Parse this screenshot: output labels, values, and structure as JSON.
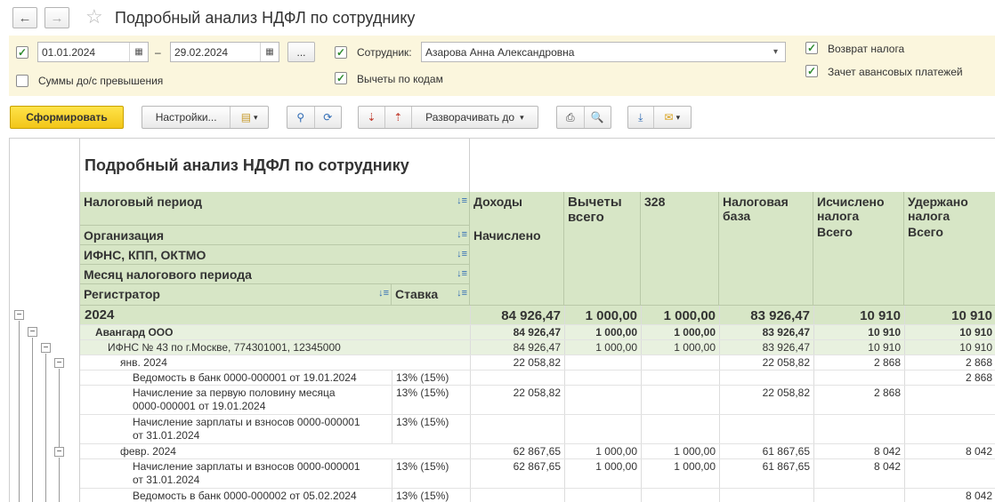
{
  "window": {
    "title": "Подробный анализ НДФЛ по сотруднику"
  },
  "filters": {
    "date_from": "01.01.2024",
    "date_to": "29.02.2024",
    "dash": "–",
    "dots": "...",
    "employee_label": "Сотрудник:",
    "employee_value": "Азарова Анна Александровна",
    "amounts_label": "Суммы до/с превышения",
    "deductions_label": "Вычеты по кодам",
    "refund_label": "Возврат налога",
    "advance_label": "Зачет авансовых платежей"
  },
  "toolbar": {
    "generate": "Сформировать",
    "settings": "Настройки...",
    "expand": "Разворачивать до"
  },
  "report": {
    "title": "Подробный анализ НДФЛ по сотруднику",
    "headers": {
      "period": "Налоговый период",
      "org": "Организация",
      "ifns": "ИФНС, КПП, ОКТМО",
      "month": "Месяц налогового периода",
      "registrar": "Регистратор",
      "rate": "Ставка",
      "income": "Доходы",
      "accrued": "Начислено",
      "deductions": "Вычеты всего",
      "code328": "328",
      "base": "Налоговая база",
      "calc": "Исчислено налога",
      "calc_total": "Всего",
      "withheld": "Удержано налога",
      "withheld_total": "Всего"
    },
    "rows": [
      {
        "label": "2024",
        "rate": "",
        "income": "84 926,47",
        "ded": "1 000,00",
        "c328": "1 000,00",
        "base": "83 926,47",
        "calc": "10 910",
        "with": "10 910"
      },
      {
        "label": "Авангард ООО",
        "rate": "",
        "income": "84 926,47",
        "ded": "1 000,00",
        "c328": "1 000,00",
        "base": "83 926,47",
        "calc": "10 910",
        "with": "10 910"
      },
      {
        "label": "ИФНС № 43 по г.Москве, 774301001, 12345000",
        "rate": "",
        "income": "84 926,47",
        "ded": "1 000,00",
        "c328": "1 000,00",
        "base": "83 926,47",
        "calc": "10 910",
        "with": "10 910"
      },
      {
        "label": "янв. 2024",
        "rate": "",
        "income": "22 058,82",
        "ded": "",
        "c328": "",
        "base": "22 058,82",
        "calc": "2 868",
        "with": "2 868"
      },
      {
        "label": "Ведомость в банк 0000-000001 от 19.01.2024",
        "rate": "13% (15%)",
        "income": "",
        "ded": "",
        "c328": "",
        "base": "",
        "calc": "",
        "with": "2 868"
      },
      {
        "label": "Начисление за первую половину месяца",
        "label2": "0000-000001 от 19.01.2024",
        "rate": "13% (15%)",
        "income": "22 058,82",
        "ded": "",
        "c328": "",
        "base": "22 058,82",
        "calc": "2 868",
        "with": ""
      },
      {
        "label": "Начисление зарплаты и взносов 0000-000001",
        "label2": "от 31.01.2024",
        "rate": "13% (15%)",
        "income": "",
        "ded": "",
        "c328": "",
        "base": "",
        "calc": "",
        "with": ""
      },
      {
        "label": "февр. 2024",
        "rate": "",
        "income": "62 867,65",
        "ded": "1 000,00",
        "c328": "1 000,00",
        "base": "61 867,65",
        "calc": "8 042",
        "with": "8 042"
      },
      {
        "label": "Начисление зарплаты и взносов 0000-000001",
        "label2": "от 31.01.2024",
        "rate": "13% (15%)",
        "income": "62 867,65",
        "ded": "1 000,00",
        "c328": "1 000,00",
        "base": "61 867,65",
        "calc": "8 042",
        "with": ""
      },
      {
        "label": "Ведомость в банк 0000-000002 от 05.02.2024",
        "rate": "13% (15%)",
        "income": "",
        "ded": "",
        "c328": "",
        "base": "",
        "calc": "",
        "with": "8 042"
      }
    ]
  },
  "colors": {
    "accent": "#f2c618",
    "header_bg": "#d7e6c6",
    "panel_bg": "#fbf6dd",
    "check": "#2e8b2e"
  },
  "icons": [
    "back-arrow-icon",
    "forward-arrow-icon",
    "star-icon",
    "calendar-icon",
    "checkbox-icon",
    "dropdown-icon",
    "search-icon",
    "search-next-icon",
    "sort-icon",
    "print-icon",
    "preview-icon",
    "download-icon",
    "mail-icon",
    "tree-collapse-icon"
  ]
}
